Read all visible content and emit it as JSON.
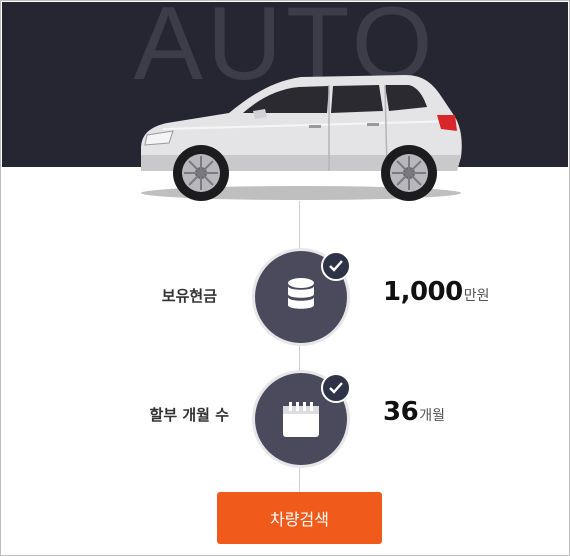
{
  "hero": {
    "background_word": "AUTO",
    "background_color": "#262632"
  },
  "steps": [
    {
      "label": "보유현금",
      "value": "1,000",
      "unit": "만원",
      "icon": "database-icon",
      "checked": true
    },
    {
      "label": "할부 개월 수",
      "value": "36",
      "unit": "개월",
      "icon": "calendar-icon",
      "checked": true
    }
  ],
  "search_button": {
    "label": "차량검색",
    "color": "#f05a1a"
  }
}
